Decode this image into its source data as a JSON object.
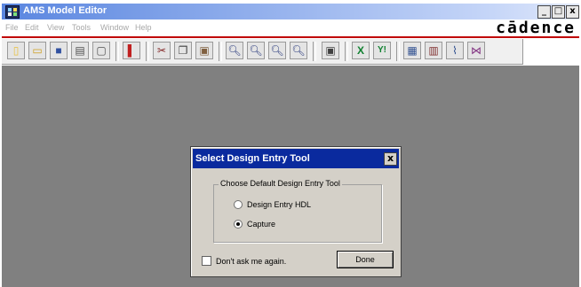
{
  "window": {
    "title": "AMS Model Editor",
    "buttons": {
      "minimize": "_",
      "maximize": "□",
      "close": "x"
    }
  },
  "menubar": {
    "items": [
      "File",
      "Edit",
      "View",
      "Tools",
      "Window",
      "Help"
    ],
    "logo": "cādence"
  },
  "toolbar": {
    "buttons": [
      {
        "icon": "new-file-icon",
        "glyph": "▯",
        "color": "#e8c040"
      },
      {
        "icon": "open-folder-icon",
        "glyph": "▭",
        "color": "#d0a020"
      },
      {
        "icon": "save-icon",
        "glyph": "■",
        "color": "#3050a0"
      },
      {
        "icon": "print-icon",
        "glyph": "▤",
        "color": "#505050"
      },
      {
        "icon": "print-preview-icon",
        "glyph": "▢",
        "color": "#505050"
      },
      {
        "icon": "book-icon",
        "glyph": "▌",
        "color": "#c02020"
      },
      {
        "icon": "cut-icon",
        "glyph": "✂",
        "color": "#802020"
      },
      {
        "icon": "copy-icon",
        "glyph": "❐",
        "color": "#404040"
      },
      {
        "icon": "paste-icon",
        "glyph": "▣",
        "color": "#806040"
      },
      {
        "icon": "zoom-in-icon",
        "glyph": "🔍︎",
        "color": "#304080"
      },
      {
        "icon": "zoom-out-icon",
        "glyph": "🔍︎",
        "color": "#304080"
      },
      {
        "icon": "zoom-fit-icon",
        "glyph": "🔍︎",
        "color": "#304080"
      },
      {
        "icon": "zoom-area-icon",
        "glyph": "🔍︎",
        "color": "#304080"
      },
      {
        "icon": "monitor-icon",
        "glyph": "▣",
        "color": "#404040"
      },
      {
        "icon": "excel-x-icon",
        "glyph": "X",
        "color": "#108030"
      },
      {
        "icon": "yi-icon",
        "glyph": "Y!",
        "color": "#108030"
      },
      {
        "icon": "window-icon",
        "glyph": "▦",
        "color": "#305090"
      },
      {
        "icon": "document-icon",
        "glyph": "▥",
        "color": "#803030"
      },
      {
        "icon": "waveform-icon",
        "glyph": "⌇",
        "color": "#305090"
      },
      {
        "icon": "chart-icon",
        "glyph": "⋈",
        "color": "#803080"
      }
    ]
  },
  "dialog": {
    "title": "Select Design Entry Tool",
    "close_glyph": "x",
    "group_label": "Choose Default Design Entry Tool",
    "options": [
      {
        "label": "Design Entry HDL",
        "selected": false
      },
      {
        "label": "Capture",
        "selected": true
      }
    ],
    "checkbox_label": "Don't ask me again.",
    "checkbox_checked": false,
    "done_label": "Done"
  }
}
